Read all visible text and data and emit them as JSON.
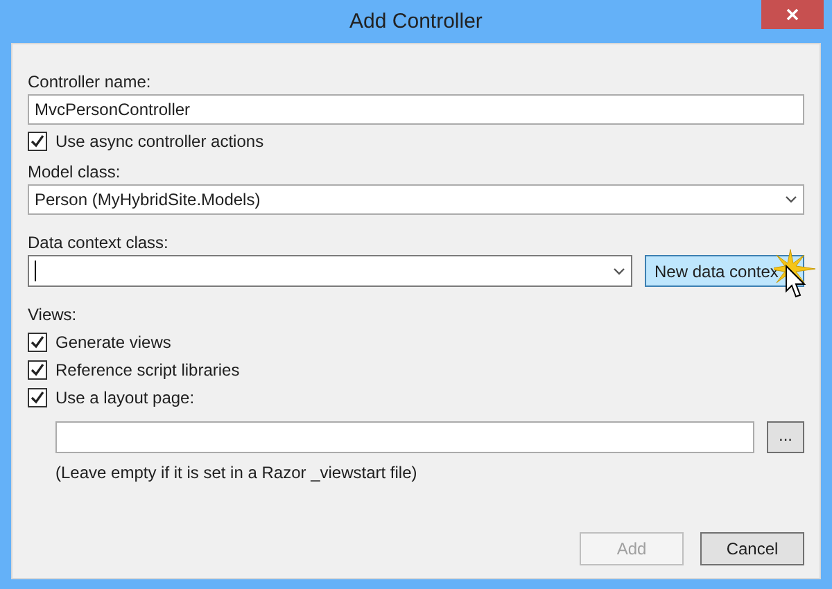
{
  "window": {
    "title": "Add Controller"
  },
  "controller_name": {
    "label": "Controller name:",
    "value": "MvcPersonController"
  },
  "async_actions": {
    "label": "Use async controller actions",
    "checked": true
  },
  "model_class": {
    "label": "Model class:",
    "value": "Person (MyHybridSite.Models)"
  },
  "data_context_class": {
    "label": "Data context class:",
    "focused": true
  },
  "new_data_context_button": {
    "label": "New data contex",
    "hovered": true
  },
  "views": {
    "label": "Views:",
    "options": [
      {
        "label": "Generate views",
        "checked": true
      },
      {
        "label": "Reference script libraries",
        "checked": true
      },
      {
        "label": "Use a layout page:",
        "checked": true
      }
    ]
  },
  "layout_page": {
    "browse_label": "...",
    "hint": "(Leave empty if it is set in a Razor _viewstart file)"
  },
  "buttons": [
    {
      "label": "Add",
      "disabled": true
    },
    {
      "label": "Cancel",
      "disabled": false
    }
  ]
}
